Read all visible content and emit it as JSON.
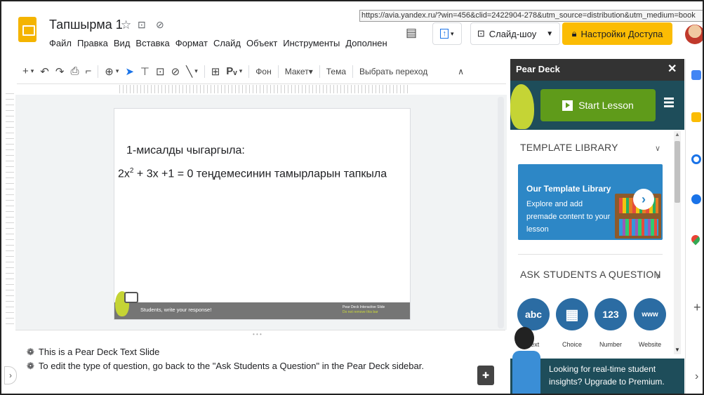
{
  "header": {
    "title": "Тапшырма 1",
    "menu": [
      "Файл",
      "Правка",
      "Вид",
      "Вставка",
      "Формат",
      "Слайд",
      "Объект",
      "Инструменты",
      "Дополнен"
    ],
    "url_tooltip": "https://avia.yandex.ru/?win=456&clid=2422904-278&utm_source=distribution&utm_medium=book",
    "slideshow_label": "Слайд-шоу",
    "share_label": "Настройки Доступа"
  },
  "toolbar": {
    "background": "Фон",
    "layout": "Макет",
    "theme": "Тема",
    "transition": "Выбрать переход"
  },
  "slide": {
    "line1": "1-мисалды чыгаргыла:",
    "line2_a": "2x",
    "line2_sup": "2",
    "line2_b": " + 3x +1 = 0 теңдемесинин тамырларын тапкыла",
    "footer": "Students, write your response!",
    "footer_brand": "Pear Deck Interactive Slide",
    "footer_sub": "Do not remove this bar"
  },
  "notes": {
    "line1": "This is a Pear Deck Text Slide",
    "line2": "To edit the type of question, go back to the \"Ask Students a Question\" in the Pear Deck sidebar."
  },
  "peardeck": {
    "title": "Pear Deck",
    "start_lesson": "Start Lesson",
    "template_section": "TEMPLATE LIBRARY",
    "template_card_title": "Our Template Library",
    "template_card_text": "Explore and add premade content to your lesson",
    "ask_section": "ASK STUDENTS A QUESTION",
    "question_types": [
      {
        "icon": "abc",
        "label": "Text"
      },
      {
        "icon": "choice",
        "label": "Choice"
      },
      {
        "icon": "123",
        "label": "Number"
      },
      {
        "icon": "www",
        "label": "Website"
      }
    ],
    "upgrade_text": "Looking for real-time student insights? Upgrade to Premium."
  },
  "colors": {
    "pear_dark": "#1e4d5a",
    "start_green": "#5f9b1a",
    "share_yellow": "#fbbc04",
    "question_blue": "#2b6ca3"
  }
}
